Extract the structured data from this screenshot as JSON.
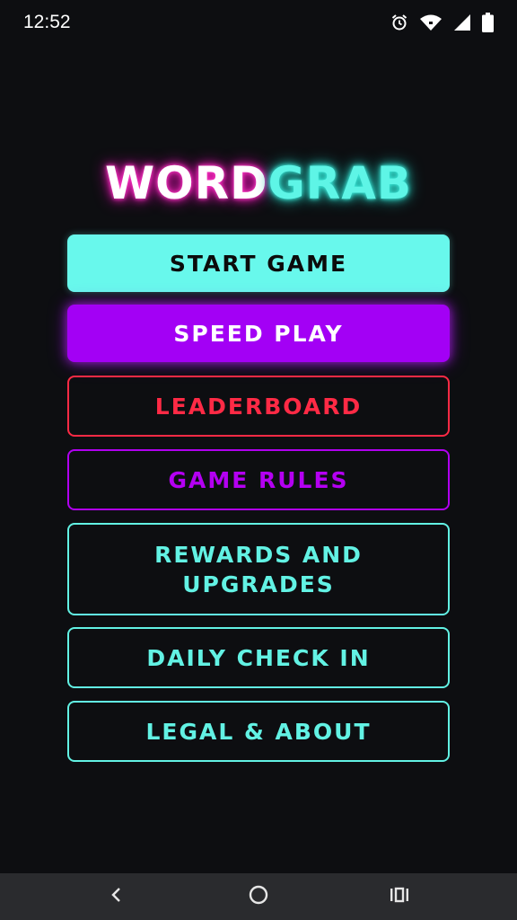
{
  "status_bar": {
    "time": "12:52",
    "icons": [
      "alarm-icon",
      "wifi-icon",
      "signal-icon",
      "battery-icon"
    ]
  },
  "logo": {
    "part1": "WORD",
    "part2": "GRAB",
    "colors": {
      "part1": "#ffffff",
      "part1_glow": "#ff2bbf",
      "part2": "#5ef5e6"
    }
  },
  "menu": {
    "start_game": "START GAME",
    "speed_play": "SPEED PLAY",
    "leaderboard": "LEADERBOARD",
    "game_rules": "GAME RULES",
    "rewards_upgrades": "REWARDS AND UPGRADES",
    "daily_check_in": "DAILY CHECK IN",
    "legal_about": "LEGAL & ABOUT"
  },
  "colors": {
    "background": "#0d0e11",
    "cyan": "#68f8ec",
    "purple": "#a300f5",
    "red": "#ff2a45",
    "violet": "#b400f2"
  },
  "nav_bar": {
    "icons": [
      "back-icon",
      "home-icon",
      "recents-icon"
    ]
  }
}
